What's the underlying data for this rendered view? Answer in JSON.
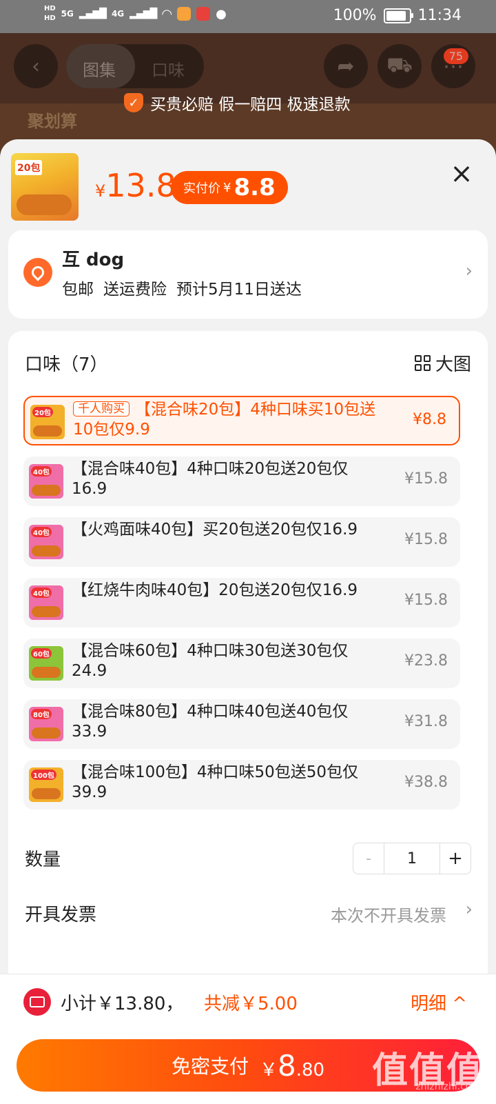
{
  "status_bar": {
    "hd1": "HD",
    "hd2": "HD",
    "net1": "5G",
    "net2": "4G",
    "battery": "100%",
    "battery_level": 1.0,
    "time": "11:34"
  },
  "background": {
    "tab_gallery": "图集",
    "tab_flavor": "口味",
    "cart_count": "75",
    "banner_text": "聚划算",
    "guarantee": "买贵必赔 假一赔四 极速退款"
  },
  "product": {
    "thumb_badge": "20包",
    "price_symbol": "¥",
    "price": "13.8",
    "pay_label": "实付价",
    "pay_symbol": "¥",
    "pay_price": "8.8"
  },
  "address": {
    "name": "互 dog",
    "shipping": [
      "包邮",
      "送运费险",
      "预计5月11日送达"
    ]
  },
  "options": {
    "title": "口味（7）",
    "big_image_label": "大图",
    "items": [
      {
        "badge": "20包",
        "hot": "千人购买",
        "text": "【混合味20包】4种口味买10包送10包仅9.9",
        "price": "¥8.8",
        "color": "#f3b02a",
        "selected": true
      },
      {
        "badge": "40包",
        "text": "【混合味40包】4种口味20包送20包仅16.9",
        "price": "¥15.8",
        "color": "#f06ea8"
      },
      {
        "badge": "40包",
        "text": "【火鸡面味40包】买20包送20包仅16.9",
        "price": "¥15.8",
        "color": "#f06ea8"
      },
      {
        "badge": "40包",
        "text": "【红烧牛肉味40包】20包送20包仅16.9",
        "price": "¥15.8",
        "color": "#f06ea8"
      },
      {
        "badge": "60包",
        "text": "【混合味60包】4种口味30包送30包仅24.9",
        "price": "¥23.8",
        "color": "#8cc43a"
      },
      {
        "badge": "80包",
        "text": "【混合味80包】4种口味40包送40包仅33.9",
        "price": "¥31.8",
        "color": "#f06ea8"
      },
      {
        "badge": "100包",
        "text": "【混合味100包】4种口味50包送50包仅39.9",
        "price": "¥38.8",
        "color": "#f3b02a"
      }
    ]
  },
  "quantity": {
    "label": "数量",
    "minus": "-",
    "value": "1",
    "plus": "+"
  },
  "invoice": {
    "label": "开具发票",
    "value": "本次不开具发票"
  },
  "footer": {
    "subtotal": "小计￥13.80，",
    "reduction": "共减￥5.00",
    "detail": "明细 ^",
    "pay_label": "免密支付",
    "pay_currency": "￥",
    "pay_int": "8",
    "pay_dec": ".80"
  },
  "watermark": {
    "logo": "值值值",
    "site": "zhizhizhi.com"
  },
  "colors": {
    "accent": "#ff5000",
    "pay_gradient_start": "#ff7a00",
    "pay_gradient_end": "#ff1f3a"
  }
}
